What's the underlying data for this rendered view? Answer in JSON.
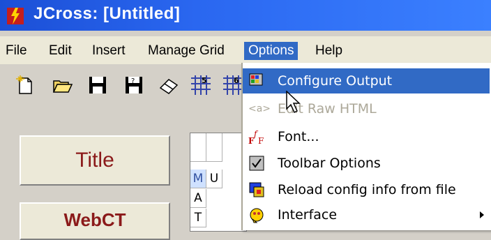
{
  "window": {
    "title": "JCross: [Untitled]"
  },
  "menubar": {
    "items": [
      {
        "label": "File"
      },
      {
        "label": "Edit"
      },
      {
        "label": "Insert"
      },
      {
        "label": "Manage Grid"
      },
      {
        "label": "Options"
      },
      {
        "label": "Help"
      }
    ]
  },
  "toolbar": {
    "icons": [
      "new-document-icon",
      "open-folder-icon",
      "save-icon",
      "save-as-icon",
      "eraser-icon",
      "crossword-5-icon",
      "crossword-6-icon"
    ]
  },
  "panel": {
    "title_button": "Title",
    "webct_button": "WebCT"
  },
  "grid": {
    "cells": [
      "M",
      "U",
      "A",
      "T"
    ]
  },
  "options_menu": {
    "items": [
      {
        "label": "Configure Output",
        "icon": "configure-output-icon",
        "highlighted": true,
        "enabled": true
      },
      {
        "label": "Edit Raw HTML",
        "icon": "raw-html-icon",
        "highlighted": false,
        "enabled": false
      },
      {
        "label": "Font...",
        "icon": "font-icon",
        "highlighted": false,
        "enabled": true
      },
      {
        "label": "Toolbar Options",
        "icon": "toolbar-options-icon",
        "highlighted": false,
        "enabled": true
      },
      {
        "label": "Reload config info from file",
        "icon": "reload-config-icon",
        "highlighted": false,
        "enabled": true
      },
      {
        "label": "Interface",
        "icon": "interface-icon",
        "highlighted": false,
        "enabled": true,
        "submenu": true
      }
    ]
  },
  "colors": {
    "titlebar": "#2a67f0",
    "highlight": "#316ac5",
    "button_text": "#8b1a1a"
  }
}
